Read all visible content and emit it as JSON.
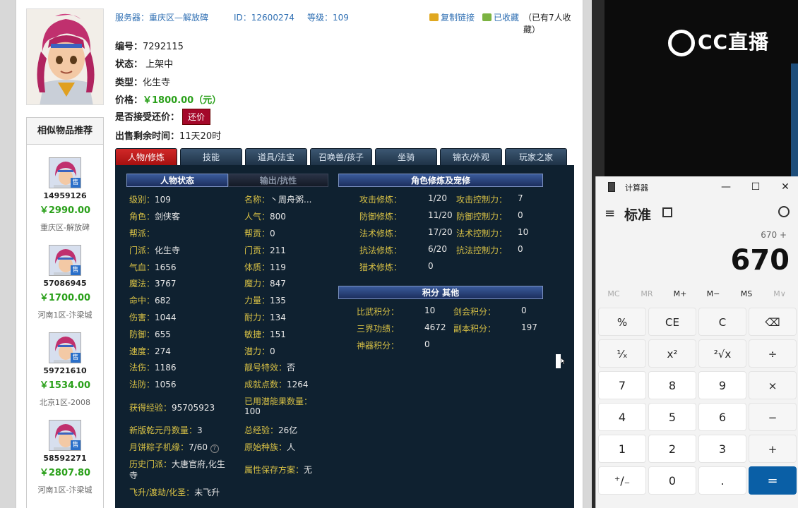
{
  "header": {
    "server_label": "服务器：",
    "server_value": "重庆区—解放碑",
    "id_label": "ID：",
    "id_value": "12600274",
    "level_label": "等级：",
    "level_value": "109",
    "copy_link": "复制链接",
    "favorited": "已收藏",
    "fav_count": "（已有7人收藏）"
  },
  "info": {
    "serial_label": "编号：",
    "serial_value": "7292115",
    "status_label": "状态：",
    "status_value": "上架中",
    "type_label": "类型：",
    "type_value": "化生寺",
    "price_label": "价格：",
    "price_value": "￥1800.00（元）",
    "counter_label": "是否接受还价：",
    "counter_button": "还价",
    "remaining_label": "出售剩余时间：",
    "remaining_value": "11天20时"
  },
  "similar": {
    "title": "相似物品推荐",
    "items": [
      {
        "id": "14959126",
        "price": "￥2990.00",
        "server": "重庆区-解放碑",
        "badge": "售"
      },
      {
        "id": "57086945",
        "price": "￥1700.00",
        "server": "河南1区-汴梁城",
        "badge": "售"
      },
      {
        "id": "59721610",
        "price": "￥1534.00",
        "server": "北京1区-2008",
        "badge": "售"
      },
      {
        "id": "58592271",
        "price": "￥2807.80",
        "server": "河南1区-汴梁城",
        "badge": "售"
      }
    ]
  },
  "tabs": [
    "人物/修炼",
    "技能",
    "道具/法宝",
    "召唤兽/孩子",
    "坐骑",
    "锦衣/外观",
    "玩家之家"
  ],
  "panel": {
    "status_head": "人物状态",
    "output_head": "输出/抗性",
    "cultivation_head": "角色修炼及宠修",
    "points_head": "积分 其他",
    "left_col": [
      {
        "k": "级别：",
        "v": "109"
      },
      {
        "k": "角色：",
        "v": "剑侠客"
      },
      {
        "k": "帮派：",
        "v": ""
      },
      {
        "k": "门派：",
        "v": "化生寺"
      },
      {
        "k": "气血：",
        "v": "1656"
      },
      {
        "k": "魔法：",
        "v": "3767"
      },
      {
        "k": "命中：",
        "v": "682"
      },
      {
        "k": "伤害：",
        "v": "1044"
      },
      {
        "k": "防御：",
        "v": "655"
      },
      {
        "k": "速度：",
        "v": "274"
      },
      {
        "k": "法伤：",
        "v": "1186"
      },
      {
        "k": "法防：",
        "v": "1056"
      }
    ],
    "mid_col": [
      {
        "k": "名称：",
        "v": "丶周舟粥..."
      },
      {
        "k": "人气：",
        "v": "800"
      },
      {
        "k": "帮贡：",
        "v": "0"
      },
      {
        "k": "门贡：",
        "v": "211"
      },
      {
        "k": "体质：",
        "v": "119"
      },
      {
        "k": "魔力：",
        "v": "847"
      },
      {
        "k": "力量：",
        "v": "135"
      },
      {
        "k": "耐力：",
        "v": "134"
      },
      {
        "k": "敏捷：",
        "v": "151"
      },
      {
        "k": "潜力：",
        "v": "0"
      },
      {
        "k": "靓号特效：",
        "v": "否"
      },
      {
        "k": "成就点数：",
        "v": "1264"
      }
    ],
    "extra": {
      "exp_k": "获得经验：",
      "exp_v": "95705923",
      "potential_k": "已用潜能果数量：",
      "potential_v": "100",
      "qianyuan_k": "新版乾元丹数量：",
      "qianyuan_v": "3",
      "totalexp_k": "总经验：",
      "totalexp_v": "26亿",
      "mooncake_k": "月饼粽子机缘：",
      "mooncake_v": "7/60",
      "race_k": "原始种族：",
      "race_v": "人",
      "history_k": "历史门派：",
      "history_v": "大唐官府,化生",
      "history_v2": "寺",
      "save_k": "属性保存方案：",
      "save_v": "无",
      "ascend_k": "飞升/渡劫/化圣：",
      "ascend_v": "未飞升"
    },
    "cultivation": [
      {
        "k": "攻击修炼：",
        "v": "1/20",
        "k2": "攻击控制力：",
        "v2": "7"
      },
      {
        "k": "防御修炼：",
        "v": "11/20",
        "k2": "防御控制力：",
        "v2": "0"
      },
      {
        "k": "法术修炼：",
        "v": "17/20",
        "k2": "法术控制力：",
        "v2": "10"
      },
      {
        "k": "抗法修炼：",
        "v": "6/20",
        "k2": "抗法控制力：",
        "v2": "0"
      },
      {
        "k": "猎术修炼：",
        "v": "0",
        "k2": "",
        "v2": ""
      }
    ],
    "points": [
      {
        "k": "比武积分：",
        "v": "10",
        "k2": "剑会积分：",
        "v2": "0"
      },
      {
        "k": "三界功绩：",
        "v": "4672",
        "k2": "副本积分：",
        "v2": "197"
      },
      {
        "k": "神器积分：",
        "v": "0",
        "k2": "",
        "v2": ""
      }
    ]
  },
  "stream": {
    "logo_text": "CC直播"
  },
  "calculator": {
    "window_title": "计算器",
    "mode": "标准",
    "expression": "670 +",
    "display": "670",
    "memory": [
      "MC",
      "MR",
      "M+",
      "M−",
      "MS",
      "M∨"
    ],
    "keys": [
      [
        "%",
        "CE",
        "C",
        "⌫"
      ],
      [
        "¹⁄ₓ",
        "x²",
        "²√x",
        "÷"
      ],
      [
        "7",
        "8",
        "9",
        "×"
      ],
      [
        "4",
        "5",
        "6",
        "−"
      ],
      [
        "1",
        "2",
        "3",
        "+"
      ],
      [
        "⁺∕₋",
        "0",
        ".",
        "="
      ]
    ]
  },
  "colors": {
    "price_green": "#2aa01a",
    "link_blue": "#2f6fb3",
    "tab_active_red": "#c41a1a",
    "panel_bg": "#0f2130",
    "key_label_yellow": "#d8c145",
    "calc_equals_blue": "#0a5fa6"
  }
}
